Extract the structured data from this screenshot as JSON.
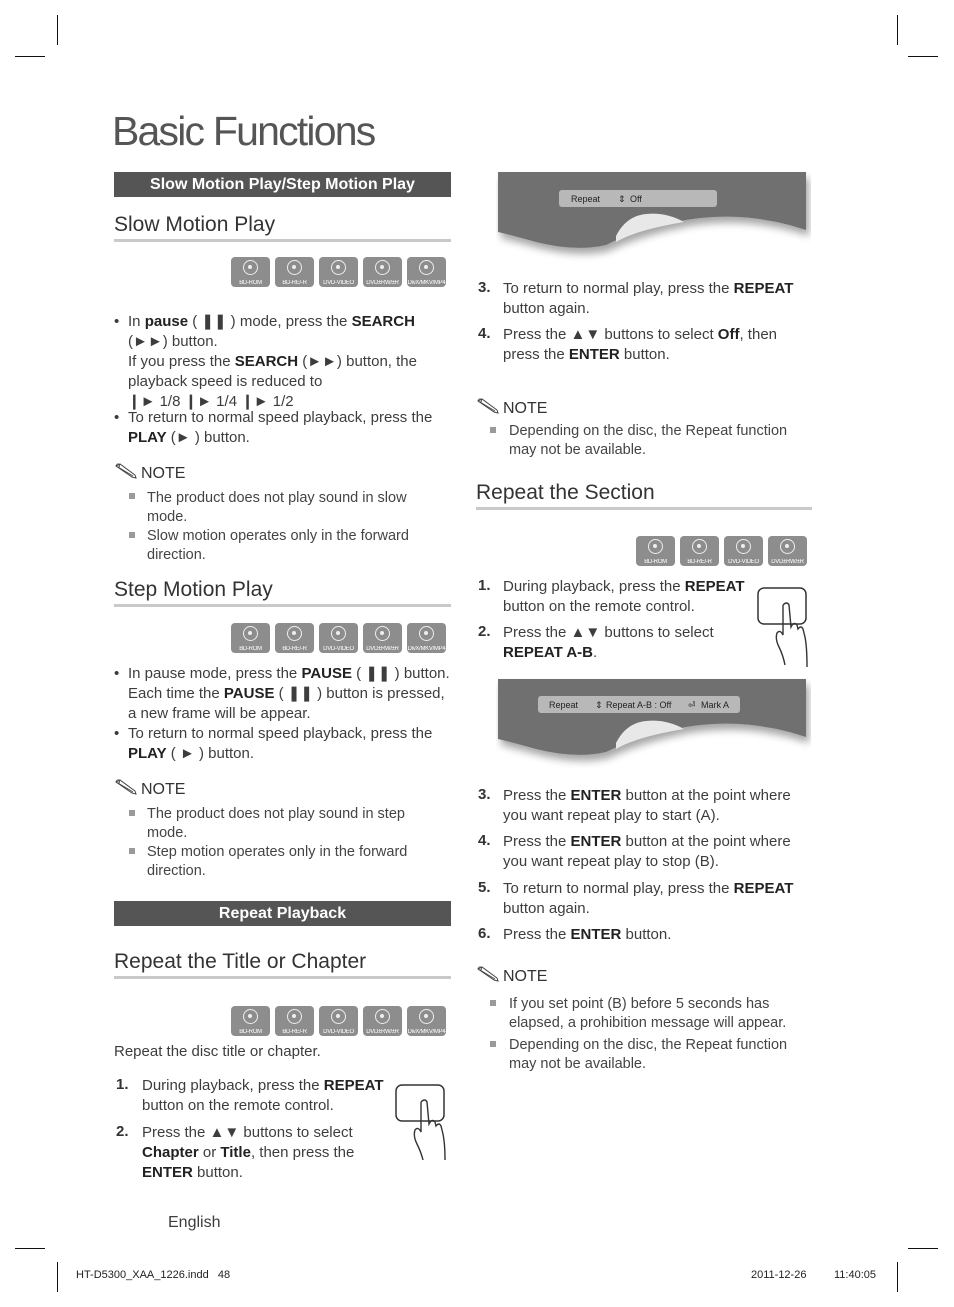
{
  "page": {
    "title": "Basic Functions",
    "language_label": "English",
    "footer_file": "HT-D5300_XAA_1226.indd   48",
    "footer_date": "2011-12-26",
    "footer_time": "11:40:05"
  },
  "sections": {
    "slow_step_band": "Slow Motion Play/Step Motion Play",
    "repeat_band": "Repeat Playback"
  },
  "disc_types": {
    "all5": [
      "BD-ROM",
      "BD-RE/-R",
      "DVD-VIDEO",
      "DVD±RW/±R",
      "DivX/MKV/MP4"
    ],
    "four": [
      "BD-ROM",
      "BD-RE/-R",
      "DVD-VIDEO",
      "DVD±RW/±R"
    ]
  },
  "slow_motion": {
    "heading": "Slow Motion Play",
    "bullets": [
      "In <b>pause</b> ( ❚❚ ) mode, press the <b>SEARCH</b> (►►) button.<br>If you press the <b>SEARCH</b> (►►) button, the playback speed is reduced to<br>❙► 1/8 ❙► 1/4 ❙► 1/2",
      "To return to normal speed playback, press the <b>PLAY</b> (► ) button."
    ],
    "note_label": "NOTE",
    "notes": [
      "The product does not play sound in slow mode.",
      "Slow motion operates only in the forward direction."
    ]
  },
  "step_motion": {
    "heading": "Step Motion Play",
    "bullets": [
      "In pause mode, press the <b>PAUSE</b> ( ❚❚ ) button. Each time the <b>PAUSE</b> ( ❚❚ ) button is pressed, a new frame will be appear.",
      "To return to normal speed playback, press the <b>PLAY</b> ( ► ) button."
    ],
    "note_label": "NOTE",
    "notes": [
      "The product does not play sound in step mode.",
      "Step motion operates only in the forward direction."
    ]
  },
  "repeat_title": {
    "heading": "Repeat the Title or Chapter",
    "intro": "Repeat the disc title or chapter.",
    "steps": [
      {
        "n": "1.",
        "text": "During playback, press the <b>REPEAT</b> button on the remote control."
      },
      {
        "n": "2.",
        "text": "Press the ▲▼ buttons to select <b>Chapter</b> or <b>Title</b>, then press the <b>ENTER</b> button."
      },
      {
        "n": "3.",
        "text": "To return to normal play, press the <b>REPEAT</b> button again."
      },
      {
        "n": "4.",
        "text": "Press the ▲▼ buttons to select <b>Off</b>, then press the <b>ENTER</b> button."
      }
    ],
    "screen": {
      "label": "Repeat",
      "value": "Off"
    },
    "note_label": "NOTE",
    "notes": [
      "Depending on the disc, the Repeat function may not be available."
    ]
  },
  "repeat_section": {
    "heading": "Repeat the Section",
    "steps": [
      {
        "n": "1.",
        "text": "During playback, press the <b>REPEAT</b> button on the remote control."
      },
      {
        "n": "2.",
        "text": "Press the ▲▼ buttons to select <b>REPEAT A-B</b>."
      },
      {
        "n": "3.",
        "text": "Press the <b>ENTER</b> button at the point where you want repeat play to start (A)."
      },
      {
        "n": "4.",
        "text": "Press the <b>ENTER</b> button at the point where you want repeat play to stop (B)."
      },
      {
        "n": "5.",
        "text": "To return to normal play, press the <b>REPEAT</b> button again."
      },
      {
        "n": "6.",
        "text": "Press the <b>ENTER</b> button."
      }
    ],
    "screen": {
      "label": "Repeat",
      "value": "Repeat A-B : Off",
      "action": "Mark A"
    },
    "note_label": "NOTE",
    "notes": [
      "If you set point (B) before 5 seconds has elapsed, a prohibition message will appear.",
      "Depending on the disc, the Repeat function may not be available."
    ]
  }
}
